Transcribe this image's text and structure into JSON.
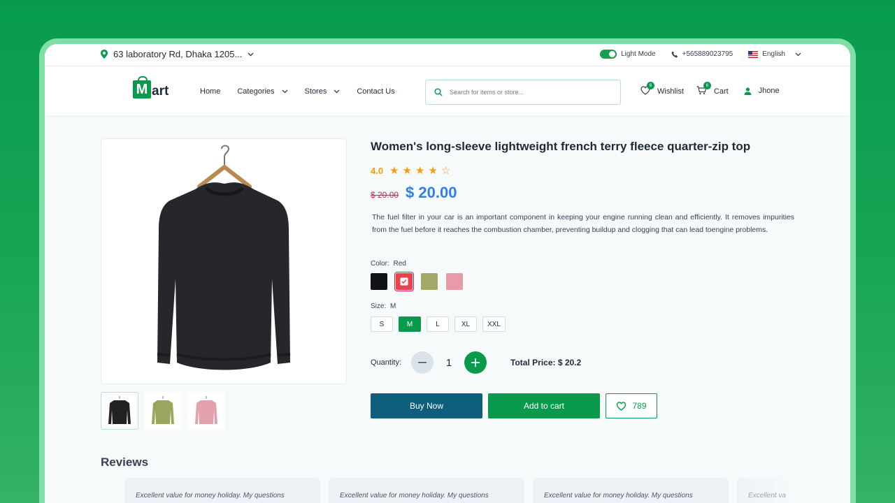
{
  "topbar": {
    "address": "63 laboratory Rd, Dhaka 1205...",
    "mode_label": "Light Mode",
    "phone": "+565889023795",
    "language": "English"
  },
  "nav": {
    "logo_letter": "M",
    "logo_rest": "art",
    "menu": [
      {
        "label": "Home"
      },
      {
        "label": "Categories"
      },
      {
        "label": "Stores"
      },
      {
        "label": "Contact Us"
      }
    ],
    "search_placeholder": "Search for items or store...",
    "wishlist_label": "Wishlist",
    "wishlist_count": "6",
    "cart_label": "Cart",
    "cart_count": "6",
    "user_name": "Jhone"
  },
  "product": {
    "title": "Women's long-sleeve lightweight french terry fleece quarter-zip top",
    "rating": "4.0",
    "rating_stars": 4,
    "old_price": "$ 20.00",
    "price": "$ 20.00",
    "description": "The fuel filter in your car is an important component in keeping your engine running clean and efficiently. It removes impurities from the fuel before it reaches the combustion chamber, preventing buildup and clogging that can lead toengine problems.",
    "color_label": "Color:",
    "color_value": "Red",
    "colors": [
      "#111318",
      "#e8434f",
      "#a3a86a",
      "#e79aa8"
    ],
    "size_label": "Size:",
    "size_value": "M",
    "sizes": [
      "S",
      "M",
      "L",
      "XL",
      "XXL"
    ],
    "quantity_label": "Quantity:",
    "quantity": "1",
    "total_price": "Total Price: $ 20.2",
    "buy_now": "Buy Now",
    "add_to_cart": "Add to cart",
    "likes": "789"
  },
  "reviews": {
    "title": "Reviews",
    "items": [
      "Excellent value for money holiday. My questions",
      "Excellent value for money holiday. My questions",
      "Excellent value for money holiday. My questions",
      "Excellent va"
    ]
  }
}
